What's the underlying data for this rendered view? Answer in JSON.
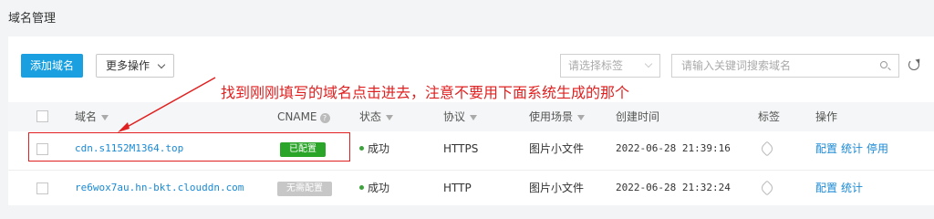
{
  "page": {
    "title": "域名管理"
  },
  "toolbar": {
    "add_domain_label": "添加域名",
    "more_actions_label": "更多操作",
    "tag_select_placeholder": "请选择标签",
    "search_placeholder": "请输入关键词搜索域名"
  },
  "table": {
    "headers": {
      "domain": "域名",
      "cname": "CNAME",
      "status": "状态",
      "protocol": "协议",
      "scenario": "使用场景",
      "created": "创建时间",
      "tags": "标签",
      "actions": "操作"
    },
    "rows": [
      {
        "domain": "cdn.s1152M1364.top",
        "cname_badge": "已配置",
        "cname_badge_color": "#2aa52a",
        "status": "成功",
        "protocol": "HTTPS",
        "scenario": "图片小文件",
        "created": "2022-06-28 21:39:16",
        "actions": [
          "配置",
          "统计",
          "停用"
        ]
      },
      {
        "domain": "re6wox7au.hn-bkt.clouddn.com",
        "cname_badge": "无需配置",
        "cname_badge_color": "#c7c7c7",
        "status": "成功",
        "protocol": "HTTP",
        "scenario": "图片小文件",
        "created": "2022-06-28 21:32:24",
        "actions": [
          "配置",
          "统计"
        ]
      }
    ]
  },
  "annotation": {
    "text": "找到刚刚填写的域名点击进去，注意不要用下面系统生成的那个",
    "color": "#e02020"
  },
  "colors": {
    "primary": "#1aa0e0",
    "link": "#1a8ad6",
    "success": "#3ca23c"
  }
}
